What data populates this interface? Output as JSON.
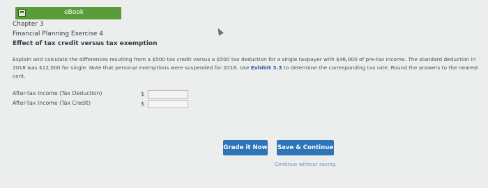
{
  "toolbar": {
    "ebook_label": "eBook",
    "ebook_icon": "ebook-icon"
  },
  "header": {
    "chapter": "Chapter 3",
    "exercise": "Financial Planning Exercise 4",
    "subtitle": "Effect of tax credit versus tax exemption"
  },
  "instructions": {
    "part1": "Explain and calculate the differences resulting from a $500 tax credit versus a $500 tax deduction for a single taxpayer with $46,000 of pre-tax income. The standard deduction in 2018 was $12,000 for single. Note that personal exemptions were suspended for 2018. Use ",
    "exhibit_link": "Exhibit 3.3",
    "part2": " to determine the corresponding tax rate. Round the answers to the nearest cent."
  },
  "fields": [
    {
      "label": "After-tax Income (Tax Deduction)",
      "currency": "$",
      "value": ""
    },
    {
      "label": "After-tax Income (Tax Credit)",
      "currency": "$",
      "value": ""
    }
  ],
  "actions": {
    "grade_label": "Grade it Now",
    "save_label": "Save & Continue",
    "continue_label": "Continue without saving"
  },
  "colors": {
    "ebook_bar": "#5a9b3a",
    "button_blue": "#2d74b8",
    "link_blue": "#2a5aa7",
    "background": "#eceeed"
  }
}
